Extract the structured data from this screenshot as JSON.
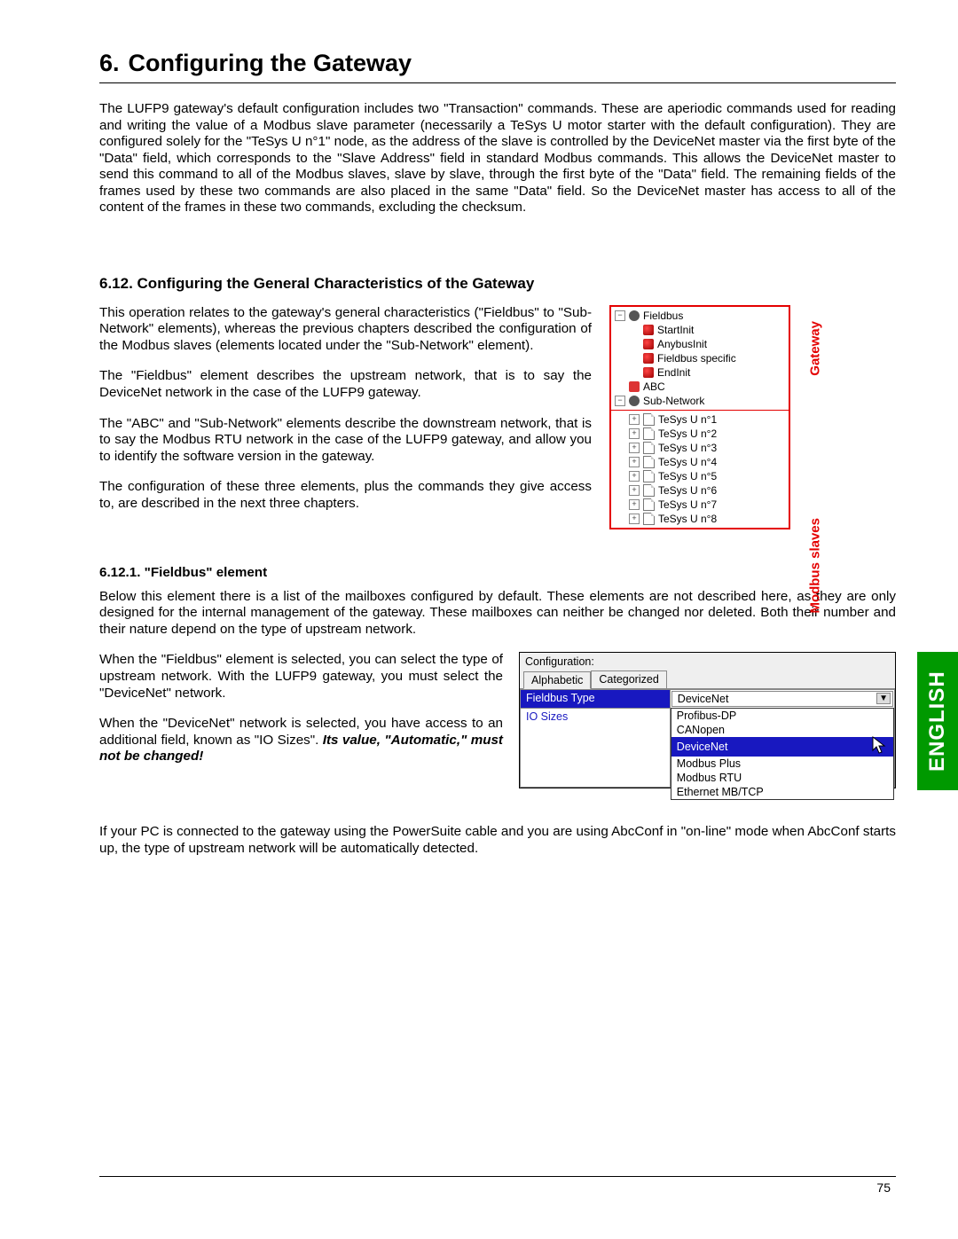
{
  "heading1_num": "6.",
  "heading1": "Configuring the Gateway",
  "intro": "The LUFP9 gateway's default configuration includes two \"Transaction\" commands. These are aperiodic commands used for reading and writing the value of a Modbus slave parameter (necessarily a TeSys U motor starter with the default configuration). They are configured solely for the \"TeSys U n°1\" node, as the address of the slave is controlled by the DeviceNet master via the first byte of the \"Data\" field, which corresponds to the \"Slave Address\" field in standard Modbus commands. This allows the DeviceNet master to send this command to all of the Modbus slaves, slave by slave, through the first byte of the \"Data\" field. The remaining fields of the frames used by these two commands are also placed in the same \"Data\" field. So the DeviceNet master has access to all of the content of the frames in these two commands, excluding the checksum.",
  "h2": "6.12. Configuring the General Characteristics of the Gateway",
  "p1": "This operation relates to the gateway's general characteristics (\"Fieldbus\" to \"Sub-Network\" elements), whereas the previous chapters described the configuration of the Modbus slaves (elements located under the \"Sub-Network\" element).",
  "p2": "The \"Fieldbus\" element describes the upstream network, that is to say the DeviceNet network in the case of the LUFP9 gateway.",
  "p3": "The \"ABC\" and \"Sub-Network\" elements describe the downstream network, that is to say the Modbus RTU network in the case of the LUFP9 gateway, and allow you to identify the software version in the gateway.",
  "p4": "The configuration of these three elements, plus the commands they give access to, are described in the next three chapters.",
  "h3": "6.12.1. \"Fieldbus\" element",
  "p5": "Below this element there is a list of the mailboxes configured by default. These elements are not described here, as they are only designed for the internal management of the gateway. These mailboxes can neither be changed nor deleted. Both their number and their nature depend on the type of upstream network.",
  "p6": "When the \"Fieldbus\" element is selected, you can select the type of upstream network. With the LUFP9 gateway, you must select the \"DeviceNet\" network.",
  "p7a": "When the \"DeviceNet\" network is selected, you have access to an additional field, known as \"IO Sizes\". ",
  "p7b": "Its value, \"Automatic,\" must not be changed!",
  "p8": "If your PC is connected to the gateway using the PowerSuite cable and you are using AbcConf in \"on-line\" mode when AbcConf starts up, the type of upstream network will be automatically detected.",
  "tree": {
    "root": "Fieldbus",
    "fieldbus_children": [
      "StartInit",
      "AnybusInit",
      "Fieldbus specific",
      "EndInit"
    ],
    "abc": "ABC",
    "subnet": "Sub-Network",
    "slaves": [
      "TeSys U n°1",
      "TeSys U n°2",
      "TeSys U n°3",
      "TeSys U n°4",
      "TeSys U n°5",
      "TeSys U n°6",
      "TeSys U n°7",
      "TeSys U n°8"
    ],
    "label_gateway": "Gateway",
    "label_slaves": "Modbus slaves"
  },
  "config": {
    "title": "Configuration:",
    "tab_alpha": "Alphabetic",
    "tab_cat": "Categorized",
    "row1_key": "Fieldbus Type",
    "row1_val": "DeviceNet",
    "row2_key": "IO Sizes",
    "options": [
      "Profibus-DP",
      "CANopen",
      "DeviceNet",
      "Modbus Plus",
      "Modbus RTU",
      "Ethernet MB/TCP"
    ]
  },
  "side_tab": "ENGLISH",
  "page_number": "75"
}
